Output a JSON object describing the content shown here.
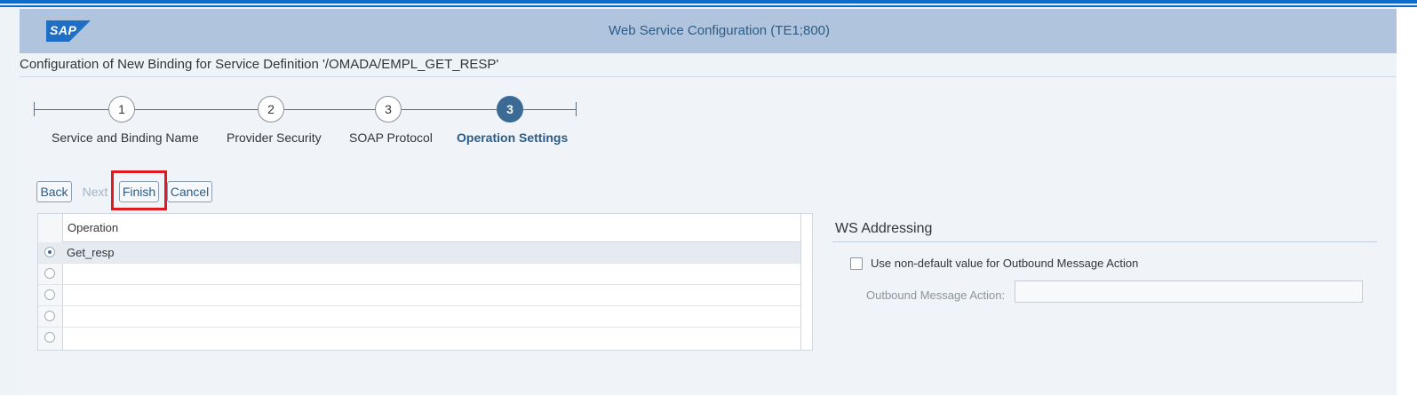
{
  "shell": {
    "title": "Web Service Configuration (TE1;800)",
    "logo_text": "SAP",
    "brand_color": "#1f6fc5"
  },
  "page": {
    "title": "Configuration of New Binding for Service Definition '/OMADA/EMPL_GET_RESP'"
  },
  "wizard": {
    "steps": [
      {
        "number": "1",
        "label": "Service and Binding Name"
      },
      {
        "number": "2",
        "label": "Provider Security"
      },
      {
        "number": "3",
        "label": "SOAP Protocol"
      },
      {
        "number": "3",
        "label": "Operation Settings",
        "active": true
      }
    ]
  },
  "toolbar": {
    "back": "Back",
    "next": "Next",
    "finish": "Finish",
    "cancel": "Cancel"
  },
  "table": {
    "column": "Operation",
    "rows": [
      {
        "value": "Get_resp",
        "selected": true
      },
      {
        "value": "",
        "selected": false
      },
      {
        "value": "",
        "selected": false
      },
      {
        "value": "",
        "selected": false
      },
      {
        "value": "",
        "selected": false
      }
    ]
  },
  "ws_addressing": {
    "title": "WS Addressing",
    "checkbox_label": "Use non-default value for Outbound Message Action",
    "checkbox_checked": false,
    "field_label": "Outbound Message Action:",
    "field_value": ""
  },
  "colors": {
    "accent": "#3b6b95",
    "highlight": "#e11a22"
  }
}
